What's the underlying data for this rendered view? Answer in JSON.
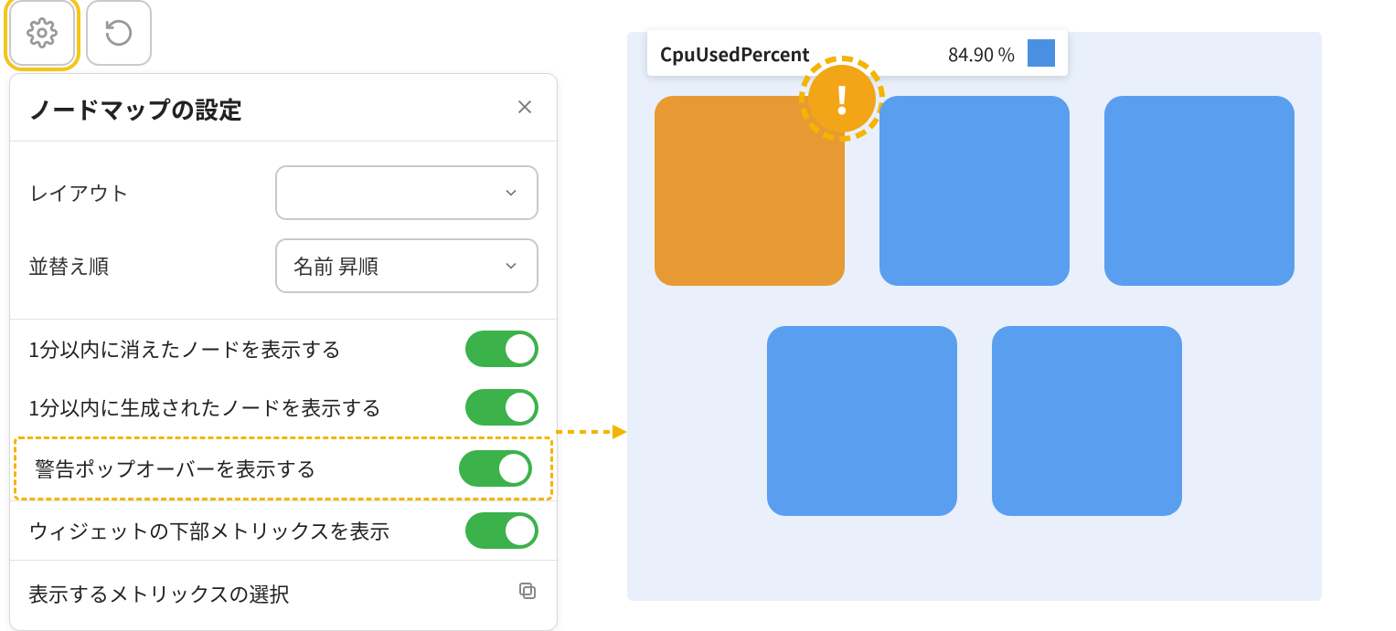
{
  "toolbar": {
    "settings_icon": "gear",
    "refresh_icon": "refresh"
  },
  "panel": {
    "title": "ノードマップの設定",
    "layout_label": "レイアウト",
    "layout_value": "",
    "sort_label": "並替え順",
    "sort_value": "名前 昇順",
    "toggles": [
      {
        "label": "1分以内に消えたノードを表示する",
        "on": true
      },
      {
        "label": "1分以内に生成されたノードを表示する",
        "on": true
      },
      {
        "label": "警告ポップオーバーを表示する",
        "on": true,
        "highlight": true
      },
      {
        "label": "ウィジェットの下部メトリックスを表示",
        "on": true
      }
    ],
    "metric_select_label": "表示するメトリックスの選択"
  },
  "tooltip": {
    "metric": "CpuUsedPercent",
    "value": "84.90 %",
    "swatch_color": "#4a90e2"
  },
  "nodes": {
    "rows": [
      [
        {
          "status": "warn",
          "alert": true
        },
        {
          "status": "ok"
        },
        {
          "status": "ok"
        }
      ],
      [
        {
          "status": "ok"
        },
        {
          "status": "ok"
        }
      ]
    ]
  },
  "colors": {
    "accent_yellow": "#f5b400",
    "toggle_green": "#3bb24a",
    "node_blue": "#5a9ef0",
    "node_warn": "#e79a33",
    "panel_border": "#d8d8d8"
  }
}
